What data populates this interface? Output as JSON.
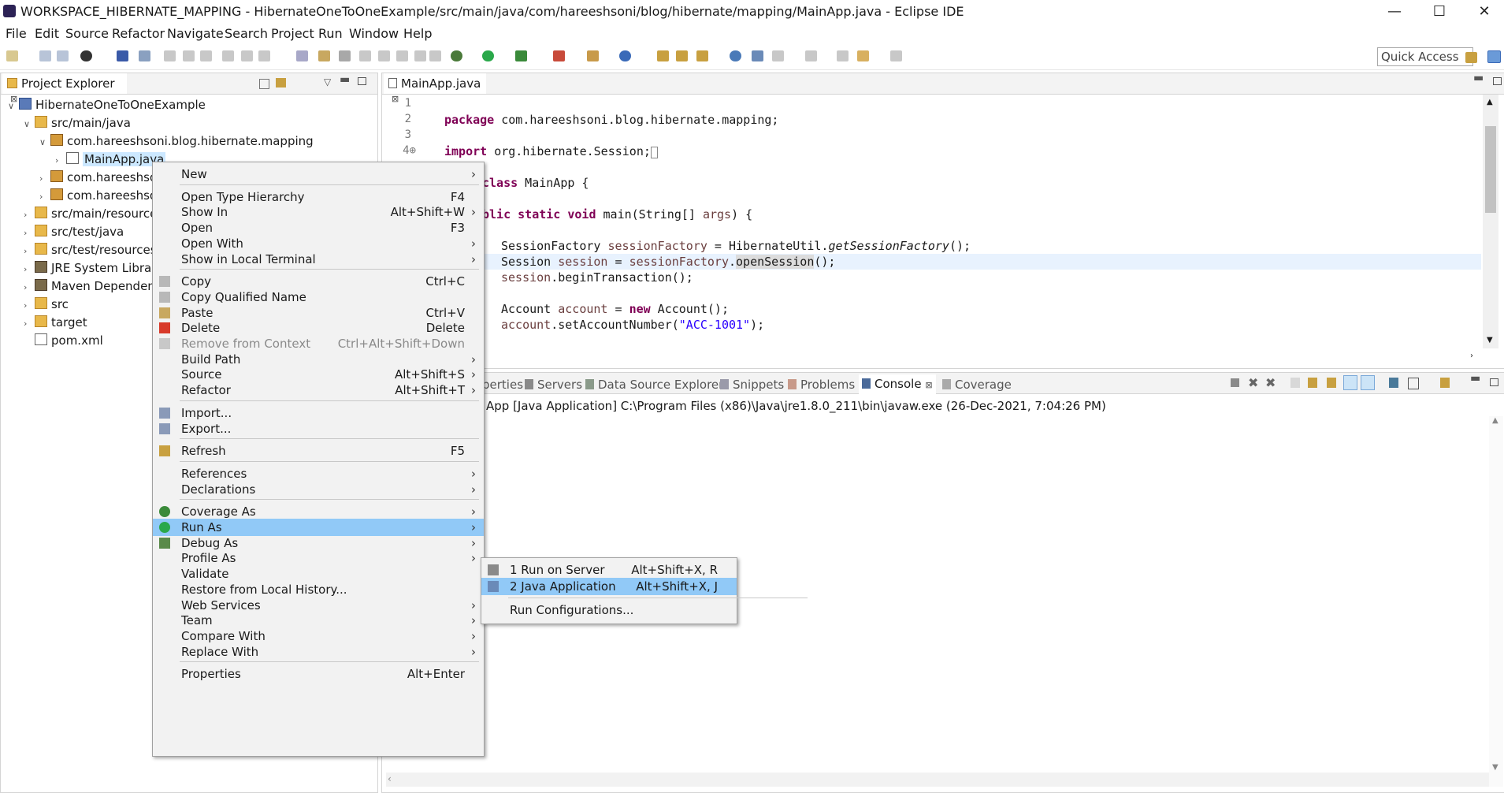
{
  "window": {
    "title": "WORKSPACE_HIBERNATE_MAPPING - HibernateOneToOneExample/src/main/java/com/hareeshsoni/blog/hibernate/mapping/MainApp.java - Eclipse IDE",
    "minimize": "—",
    "maximize": "☐",
    "close": "✕"
  },
  "menubar": [
    "File",
    "Edit",
    "Source",
    "Refactor",
    "Navigate",
    "Search",
    "Project",
    "Run",
    "Window",
    "Help"
  ],
  "toolbar": {
    "quick_access": "Quick Access"
  },
  "project_explorer": {
    "tab": "Project Explorer",
    "close": "⊠",
    "tree": [
      {
        "label": "HibernateOneToOneExample",
        "icon": "project-icon"
      },
      {
        "label": "src/main/java",
        "icon": "source-folder-icon"
      },
      {
        "label": "com.hareeshsoni.blog.hibernate.mapping",
        "icon": "package-icon"
      },
      {
        "label": "MainApp.java",
        "icon": "java-file-icon"
      },
      {
        "label": "com.hareeshson",
        "icon": "package-icon"
      },
      {
        "label": "com.hareeshson",
        "icon": "package-icon"
      },
      {
        "label": "src/main/resources",
        "icon": "source-folder-icon"
      },
      {
        "label": "src/test/java",
        "icon": "source-folder-icon"
      },
      {
        "label": "src/test/resources",
        "icon": "source-folder-icon"
      },
      {
        "label": "JRE System Library",
        "icon": "library-icon"
      },
      {
        "label": "Maven Dependenci",
        "icon": "library-icon"
      },
      {
        "label": "src",
        "icon": "folder-icon"
      },
      {
        "label": "target",
        "icon": "folder-icon"
      },
      {
        "label": "pom.xml",
        "icon": "xml-file-icon"
      }
    ]
  },
  "editor": {
    "tab": "MainApp.java",
    "close": "⊠",
    "line_numbers": [
      "1",
      "2",
      "3",
      "4⊕"
    ],
    "code": {
      "package_kw": "package",
      "package_name": " com.hareeshsoni.blog.hibernate.mapping;",
      "import_kw": "import",
      "import_name": " org.hibernate.Session;",
      "class_kw": "class",
      "class_name": " MainApp {",
      "public_frag": "blic ",
      "static_kw": "static",
      "void_kw": "void",
      "main_sig": " main(String[] ",
      "args": "args",
      "main_end": ") {",
      "l1_type": "SessionFactory ",
      "l1_var": "sessionFactory",
      "l1_mid": " = HibernateUtil.",
      "l1_call": "getSessionFactory",
      "l1_end": "();",
      "l2_type": "Session ",
      "l2_var": "session",
      "l2_mid": " = ",
      "l2_obj": "sessionFactory",
      "l2_dot": ".",
      "l2_call": "openSession",
      "l2_end": "();",
      "l3_var": "session",
      "l3_rest": ".beginTransaction();",
      "l4_type": "Account ",
      "l4_var": "account",
      "l4_mid": " = ",
      "l4_new": "new",
      "l4_end": " Account();",
      "l5_var": "account",
      "l5_mid": ".setAccountNumber(",
      "l5_str": "\"ACC-1001\"",
      "l5_end": ");"
    }
  },
  "bottom_tabs": [
    {
      "label": "perties",
      "icon": "properties-icon"
    },
    {
      "label": "Servers",
      "icon": "servers-icon"
    },
    {
      "label": "Data Source Explorer",
      "icon": "datasource-icon"
    },
    {
      "label": "Snippets",
      "icon": "snippets-icon"
    },
    {
      "label": "Problems",
      "icon": "problems-icon"
    },
    {
      "label": "Console",
      "icon": "console-icon",
      "active": true
    },
    {
      "label": "Coverage",
      "icon": "coverage-icon"
    }
  ],
  "console": {
    "status": "App [Java Application] C:\\Program Files (x86)\\Java\\jre1.8.0_211\\bin\\javaw.exe (26-Dec-2021, 7:04:26 PM)",
    "close": "⊠"
  },
  "context_menu": {
    "items": [
      {
        "label": "New",
        "submenu": true
      },
      {
        "sep": true
      },
      {
        "label": "Open Type Hierarchy",
        "shortcut": "F4"
      },
      {
        "label": "Show In",
        "shortcut": "Alt+Shift+W",
        "submenu": true
      },
      {
        "label": "Open",
        "shortcut": "F3"
      },
      {
        "label": "Open With",
        "submenu": true
      },
      {
        "label": "Show in Local Terminal",
        "submenu": true
      },
      {
        "sep": true
      },
      {
        "label": "Copy",
        "shortcut": "Ctrl+C",
        "icon": "copy-icon"
      },
      {
        "label": "Copy Qualified Name",
        "icon": "copy-qualified-icon"
      },
      {
        "label": "Paste",
        "shortcut": "Ctrl+V",
        "icon": "paste-icon"
      },
      {
        "label": "Delete",
        "shortcut": "Delete",
        "icon": "delete-icon"
      },
      {
        "label": "Remove from Context",
        "shortcut": "Ctrl+Alt+Shift+Down",
        "disabled": true,
        "icon": "remove-context-icon"
      },
      {
        "label": "Build Path",
        "submenu": true
      },
      {
        "label": "Source",
        "shortcut": "Alt+Shift+S",
        "submenu": true
      },
      {
        "label": "Refactor",
        "shortcut": "Alt+Shift+T",
        "submenu": true
      },
      {
        "sep": true
      },
      {
        "label": "Import...",
        "icon": "import-icon"
      },
      {
        "label": "Export...",
        "icon": "export-icon"
      },
      {
        "sep": true
      },
      {
        "label": "Refresh",
        "shortcut": "F5",
        "icon": "refresh-icon"
      },
      {
        "sep": true
      },
      {
        "label": "References",
        "submenu": true
      },
      {
        "label": "Declarations",
        "submenu": true
      },
      {
        "sep": true
      },
      {
        "label": "Coverage As",
        "submenu": true,
        "icon": "coverage-as-icon"
      },
      {
        "label": "Run As",
        "submenu": true,
        "highlighted": true,
        "icon": "run-icon"
      },
      {
        "label": "Debug As",
        "submenu": true,
        "icon": "debug-icon"
      },
      {
        "label": "Profile As",
        "submenu": true
      },
      {
        "label": "Validate"
      },
      {
        "label": "Restore from Local History..."
      },
      {
        "label": "Web Services",
        "submenu": true
      },
      {
        "label": "Team",
        "submenu": true
      },
      {
        "label": "Compare With",
        "submenu": true
      },
      {
        "label": "Replace With",
        "submenu": true
      },
      {
        "sep": true
      },
      {
        "label": "Properties",
        "shortcut": "Alt+Enter"
      }
    ]
  },
  "run_as_submenu": {
    "items": [
      {
        "label": "1 Run on Server",
        "shortcut": "Alt+Shift+X, R",
        "icon": "server-icon"
      },
      {
        "label": "2 Java Application",
        "shortcut": "Alt+Shift+X, J",
        "icon": "java-app-icon",
        "highlighted": true
      },
      {
        "sep": true
      },
      {
        "label": "Run Configurations..."
      }
    ]
  },
  "colors": {
    "menu_highlight": "#91c9f7",
    "keyword": "#7f0055",
    "field": "#0000c0",
    "string": "#2a00ff",
    "local_var": "#6a3e3e"
  }
}
